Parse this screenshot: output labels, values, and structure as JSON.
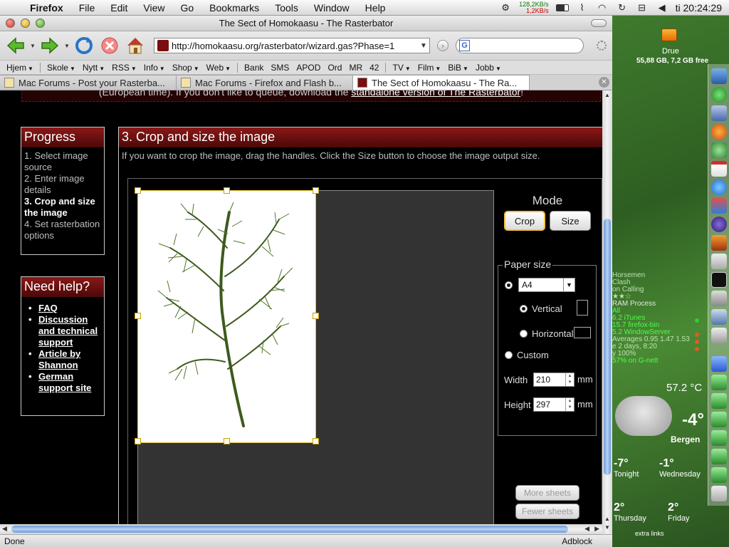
{
  "menubar": {
    "app": "Firefox",
    "items": [
      "File",
      "Edit",
      "View",
      "Go",
      "Bookmarks",
      "Tools",
      "Window",
      "Help"
    ],
    "net_up": "128,2KB/s",
    "net_down": "1,2KB/s",
    "clock": "ti 20:24:29"
  },
  "window": {
    "title": "The Sect of Homokaasu - The Rasterbator",
    "url": "http://homokaasu.org/rasterbator/wizard.gas?Phase=1",
    "search_placeholder": ""
  },
  "bookmarks": [
    {
      "label": "Hjem",
      "dd": true
    },
    {
      "label": "Skole",
      "dd": true
    },
    {
      "label": "Nytt",
      "dd": true
    },
    {
      "label": "RSS",
      "dd": true
    },
    {
      "label": "Info",
      "dd": true
    },
    {
      "label": "Shop",
      "dd": true
    },
    {
      "label": "Web",
      "dd": true
    },
    {
      "label": "Bank",
      "dd": false
    },
    {
      "label": "SMS",
      "dd": false
    },
    {
      "label": "APOD",
      "dd": false
    },
    {
      "label": "Ord",
      "dd": false
    },
    {
      "label": "MR",
      "dd": false
    },
    {
      "label": "42",
      "dd": false
    },
    {
      "label": "TV",
      "dd": true
    },
    {
      "label": "Film",
      "dd": true
    },
    {
      "label": "BiB",
      "dd": true
    },
    {
      "label": "Jobb",
      "dd": true
    }
  ],
  "tabs": [
    {
      "label": "Mac Forums - Post your Rasterba..."
    },
    {
      "label": "Mac Forums - Firefox and Flash b..."
    },
    {
      "label": "The Sect of Homokaasu - The Ra..."
    }
  ],
  "page": {
    "notice_before": "(European time). If you don't like to queue, download the",
    "notice_link": "standalone version of The Rasterbator",
    "notice_after": "!",
    "progress": {
      "title": "Progress",
      "steps": [
        "1. Select image source",
        "2. Enter image details",
        "3. Crop and size the image",
        "4. Set rasterbation options"
      ],
      "current_step": "3. Crop and size the image"
    },
    "help": {
      "title": "Need help?",
      "links": [
        "FAQ",
        "Discussion and technical support",
        "Article by Shannon",
        "German support site"
      ]
    },
    "step_title": "3. Crop and size the image",
    "instructions": "If you want to crop the image, drag the handles. Click the Size button to choose the image output size.",
    "mode": {
      "label": "Mode",
      "crop": "Crop",
      "size": "Size",
      "selected": "Crop"
    },
    "paper": {
      "legend": "Paper size",
      "preset": "A4",
      "vertical": "Vertical",
      "horizontal": "Horizontal",
      "custom": "Custom",
      "width_label": "Width",
      "width_value": "210",
      "height_label": "Height",
      "height_value": "297",
      "unit": "mm"
    },
    "more_sheets": "More sheets",
    "fewer_sheets": "Fewer sheets"
  },
  "statusbar": {
    "status": "Done",
    "adblock": "Adblock"
  },
  "desktop": {
    "drive_name": "Drue",
    "drive_info": "55,88 GB, 7,2 GB free",
    "stats_lines": [
      "Horsemen",
      "Clash",
      "on Calling"
    ],
    "stats_header": "RAM  Process",
    "stats_rows": [
      "All",
      "6.2    iTunes",
      "15.7   firefox-bin",
      "5.2    WindowServer",
      "Averages 0.95 1.47 1.53",
      "e 2 days, 8:20",
      "y 100%",
      "57% on G-nett"
    ],
    "weather_temp_top": "57.2 °C",
    "weather_now": "-4°",
    "weather_city": "Bergen",
    "forecast": [
      {
        "t": "-7°",
        "d": "Tonight"
      },
      {
        "t": "-1°",
        "d": "Wednesday"
      },
      {
        "t": "2°",
        "d": "Thursday"
      },
      {
        "t": "2°",
        "d": "Friday"
      }
    ],
    "extra_links": "extra links"
  }
}
